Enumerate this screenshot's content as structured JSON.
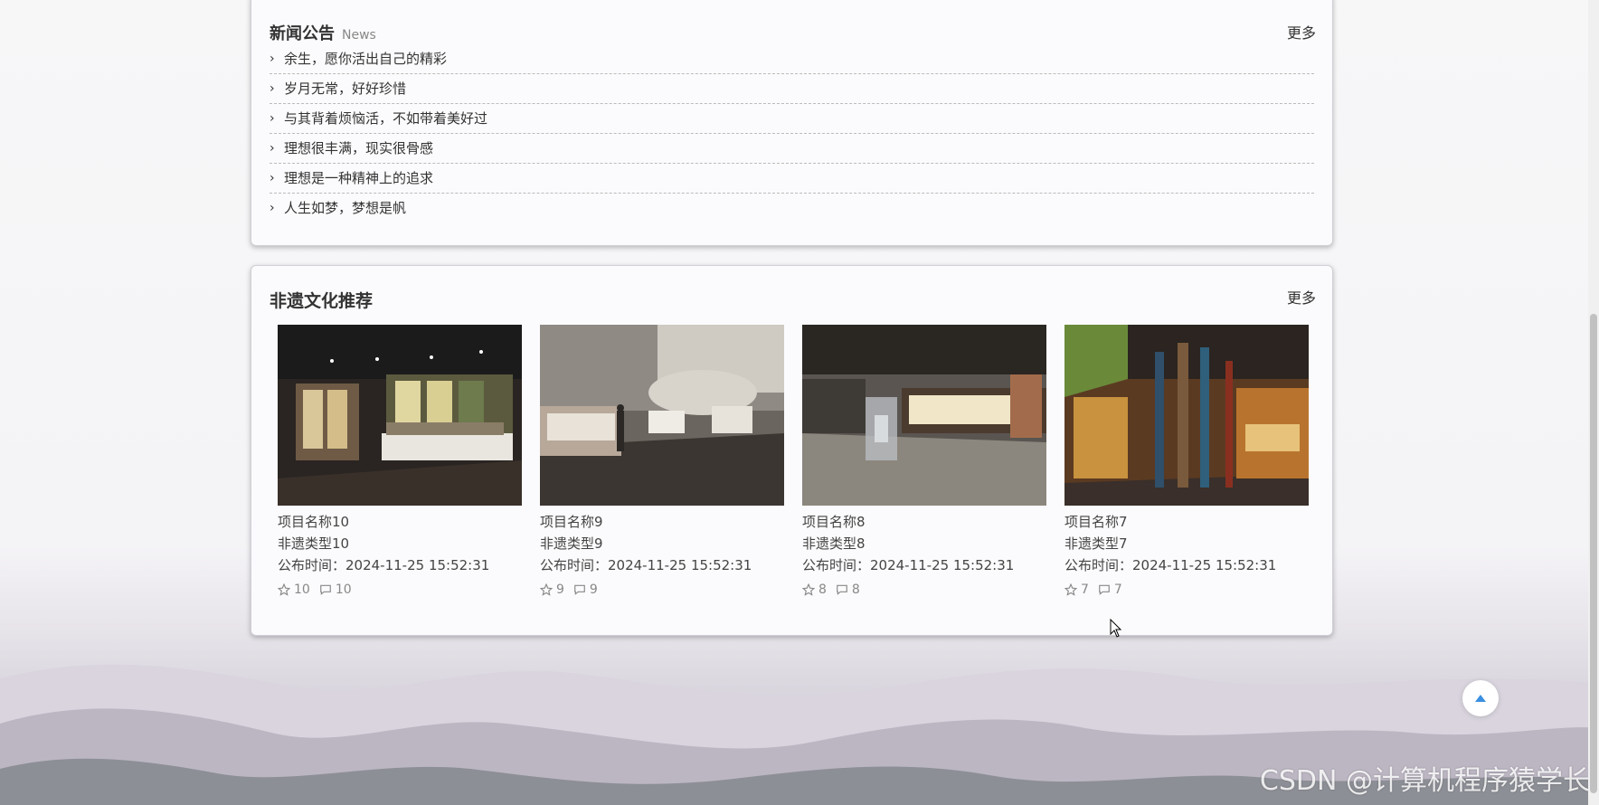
{
  "news": {
    "title": "新闻公告",
    "subtitle": "News",
    "more": "更多",
    "items": [
      {
        "text": "余生，愿你活出自己的精彩"
      },
      {
        "text": "岁月无常，好好珍惜"
      },
      {
        "text": "与其背着烦恼活，不如带着美好过"
      },
      {
        "text": "理想很丰满，现实很骨感"
      },
      {
        "text": "理想是一种精神上的追求"
      },
      {
        "text": "人生如梦，梦想是帆"
      }
    ]
  },
  "recommend": {
    "title": "非遗文化推荐",
    "more": "更多",
    "cards": [
      {
        "name": "项目名称10",
        "type": "非遗类型10",
        "time": "公布时间：2024-11-25 15:52:31",
        "likes": "10",
        "comments": "10"
      },
      {
        "name": "项目名称9",
        "type": "非遗类型9",
        "time": "公布时间：2024-11-25 15:52:31",
        "likes": "9",
        "comments": "9"
      },
      {
        "name": "项目名称8",
        "type": "非遗类型8",
        "time": "公布时间：2024-11-25 15:52:31",
        "likes": "8",
        "comments": "8"
      },
      {
        "name": "项目名称7",
        "type": "非遗类型7",
        "time": "公布时间：2024-11-25 15:52:31",
        "likes": "7",
        "comments": "7"
      }
    ]
  },
  "watermark": "CSDN @计算机程序猿学长",
  "colors": {
    "panel_bg": "#fbfbfd",
    "accent_blue": "#3b8fe0"
  }
}
